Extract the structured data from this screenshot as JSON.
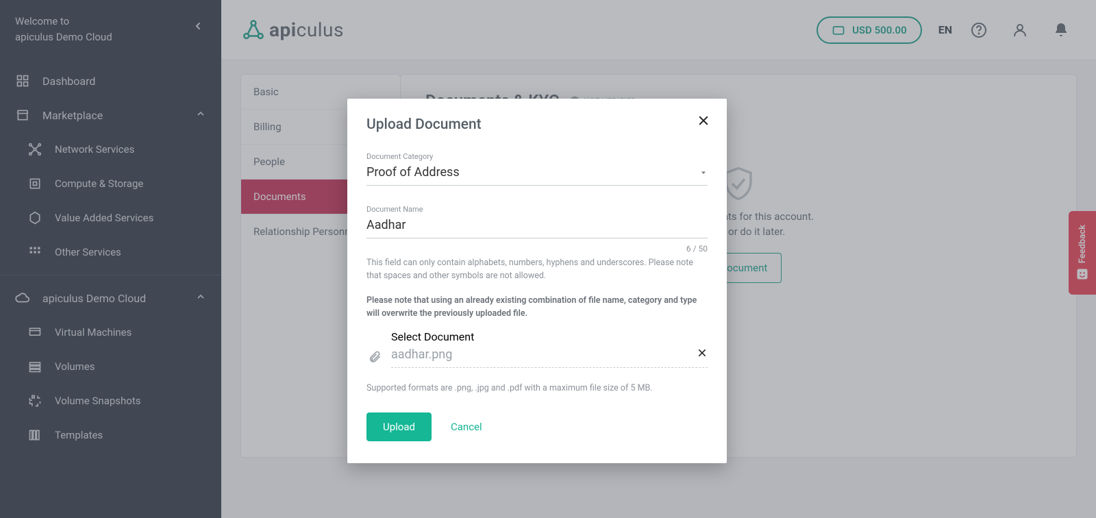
{
  "welcome": {
    "line1": "Welcome to",
    "line2": "apiculus Demo Cloud"
  },
  "nav": {
    "dashboard": "Dashboard",
    "marketplace": "Marketplace",
    "network_services": "Network Services",
    "compute_storage": "Compute & Storage",
    "value_added": "Value Added Services",
    "other_services": "Other Services",
    "tenant": "apiculus Demo Cloud",
    "virtual_machines": "Virtual Machines",
    "volumes": "Volumes",
    "volume_snapshots": "Volume Snapshots",
    "templates": "Templates"
  },
  "header": {
    "logo1": "api",
    "logo2": "culus",
    "balance": "USD 500.00",
    "lang": "EN"
  },
  "tabs": {
    "basic": "Basic",
    "billing": "Billing",
    "people": "People",
    "documents": "Documents",
    "relationship": "Relationship Personnel"
  },
  "content": {
    "title": "Documents & KYC",
    "not_verified": "NOT VERIFIED",
    "empty_line1_suffix": "ntity documents for this account.",
    "empty_line2_suffix": "es now, or do it later.",
    "add_button_suffix": "ty Document"
  },
  "feedback": {
    "label": "Feedback"
  },
  "modal": {
    "title": "Upload Document",
    "category_label": "Document Category",
    "category_value": "Proof of Address",
    "name_label": "Document Name",
    "name_value": "Aadhar",
    "counter": "6 / 50",
    "help1": "This field can only contain alphabets, numbers, hyphens and underscores. Please note that spaces and other symbols are not allowed.",
    "help2": "Please note that using an already existing combination of file name, category and type will overwrite the previously uploaded file.",
    "select_label": "Select Document",
    "file_name": "aadhar.png",
    "formats": "Supported formats are .png, .jpg and .pdf with a maximum file size of 5 MB.",
    "upload": "Upload",
    "cancel": "Cancel"
  }
}
